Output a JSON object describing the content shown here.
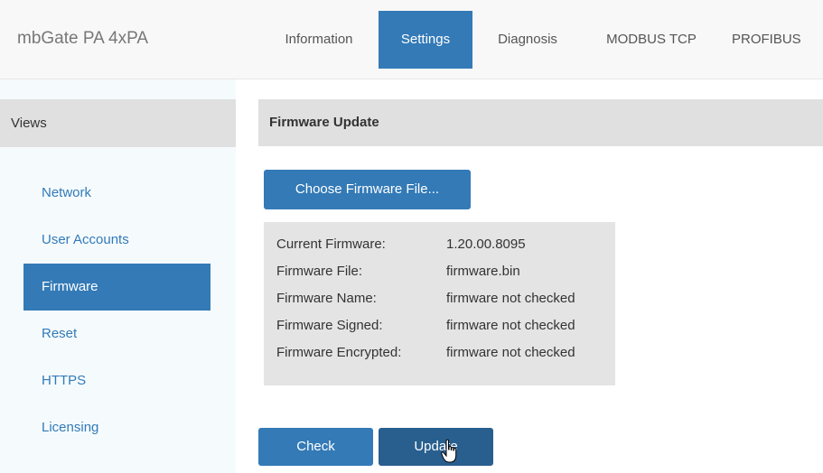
{
  "app": {
    "brand": "mbGate PA 4xPA"
  },
  "nav": {
    "tabs": [
      {
        "label": "Information"
      },
      {
        "label": "Settings",
        "active": true
      },
      {
        "label": "Diagnosis"
      },
      {
        "label": "MODBUS TCP"
      },
      {
        "label": "PROFIBUS"
      }
    ]
  },
  "sidebar": {
    "header": "Views",
    "items": [
      {
        "label": "Network"
      },
      {
        "label": "User Accounts"
      },
      {
        "label": "Firmware",
        "active": true
      },
      {
        "label": "Reset"
      },
      {
        "label": "HTTPS"
      },
      {
        "label": "Licensing"
      }
    ]
  },
  "main": {
    "panel_title": "Firmware Update",
    "choose_button": "Choose Firmware File...",
    "info": [
      {
        "key": "Current Firmware:",
        "value": "1.20.00.8095"
      },
      {
        "key": "Firmware File:",
        "value": "firmware.bin"
      },
      {
        "key": "Firmware Name:",
        "value": "firmware not checked"
      },
      {
        "key": "Firmware Signed:",
        "value": "firmware not checked"
      },
      {
        "key": "Firmware Encrypted:",
        "value": "firmware not checked"
      }
    ],
    "check_button": "Check",
    "update_button": "Update"
  },
  "colors": {
    "accent": "#337ab7",
    "accent_dark": "#295f8f"
  },
  "icons": {
    "cursor": "hand-pointer-icon"
  }
}
